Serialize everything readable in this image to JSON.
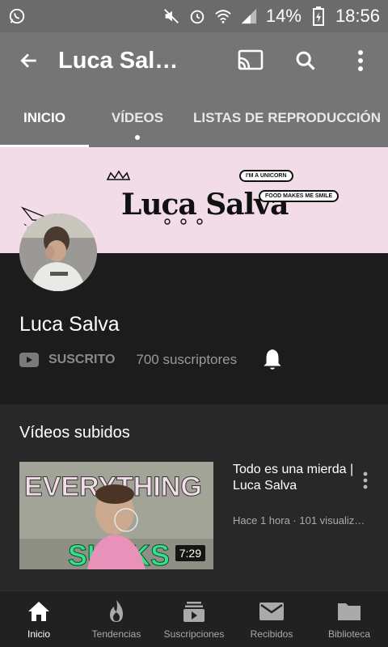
{
  "status_bar": {
    "battery": "14%",
    "time": "18:56"
  },
  "app_bar": {
    "title": "Luca Sal…"
  },
  "tabs": [
    {
      "label": "INICIO",
      "active": true
    },
    {
      "label": "VÍDEOS",
      "active": false,
      "has_new": true
    },
    {
      "label": "LISTAS DE REPRODUCCIÓN",
      "active": false
    }
  ],
  "banner": {
    "logo_text": "Luca Salva",
    "bubble_1": "I'M A UNICORN",
    "bubble_2": "FOOD MAKES ME SMILE"
  },
  "channel": {
    "name": "Luca Salva",
    "subscribe_status": "SUSCRITO",
    "subscribers": "700 suscriptores"
  },
  "section": {
    "title": "Vídeos subidos",
    "video": {
      "title": "Todo es una mierda | Luca Salva",
      "meta": "Hace 1 hora · 101 visualiz…",
      "duration": "7:29",
      "thumb_text_top": "EVERYTHING",
      "thumb_text_bottom": "SUCKS"
    }
  },
  "bottom_nav": [
    {
      "label": "Inicio",
      "icon": "home-icon",
      "active": true
    },
    {
      "label": "Tendencias",
      "icon": "flame-icon",
      "active": false
    },
    {
      "label": "Suscripciones",
      "icon": "subscriptions-icon",
      "active": false
    },
    {
      "label": "Recibidos",
      "icon": "mail-icon",
      "active": false
    },
    {
      "label": "Biblioteca",
      "icon": "folder-icon",
      "active": false
    }
  ]
}
